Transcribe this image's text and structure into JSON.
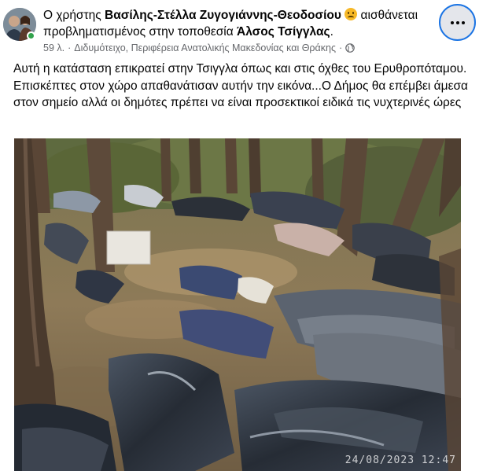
{
  "header": {
    "prefix": "Ο χρήστης",
    "author": "Βασίλης-Στέλλα Ζυγογιάννης-Θεοδοσίου",
    "feeling": "αισθάνεται προβληματισμένος στην τοποθεσία",
    "location": "Άλσος Τσίγγλας",
    "period": ".",
    "feeling_icon": "worried-face-emoji"
  },
  "meta": {
    "time": "59 λ.",
    "separator": "·",
    "place": "Διδυμότειχο, Περιφέρεια Ανατολικής Μακεδονίας και Θράκης",
    "separator2": "·",
    "privacy_icon": "globe-icon"
  },
  "more_button": {
    "icon": "more-horizontal-icon"
  },
  "post": {
    "text": "Αυτή η κατάσταση επικρατεί στην Τσιγγλα όπως και στις όχθες του Ερυθροπόταμου. Επισκέπτες στον χώρο απαθανάτισαν αυτήν την εικόνα...Ο Δήμος θα επέμβει άμεσα στον σημείο αλλά οι δημότες πρέπει να είναι προσεκτικοί ειδικά τις νυχτερινές ώρες"
  },
  "photo": {
    "timestamp": "24/08/2023 12:47",
    "colors": {
      "trunk": "#5a4636",
      "ground": "#8a7656",
      "tarp": "#2d3440",
      "foliage": "#5f6a3a"
    }
  }
}
